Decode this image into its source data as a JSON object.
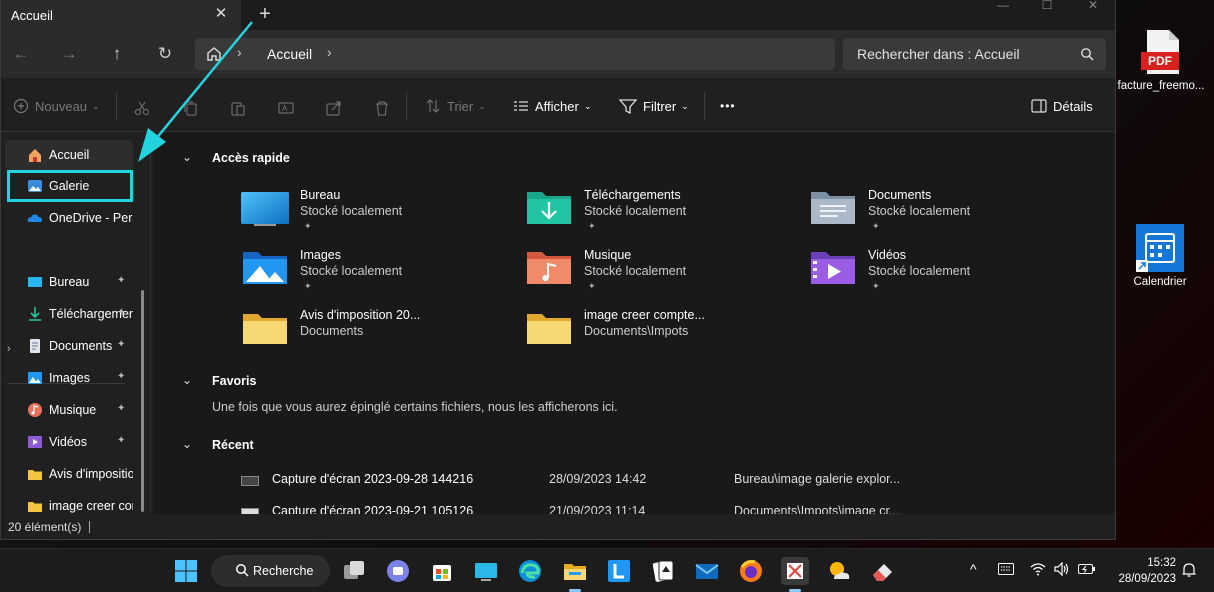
{
  "window": {
    "tab_title": "Accueil",
    "tab_close": "✕",
    "tab_new": "+",
    "controls": [
      "—",
      "☐",
      "✕"
    ]
  },
  "nav": {
    "back": "←",
    "forward": "→",
    "up": "↑",
    "refresh": "↻",
    "breadcrumb": "Accueil",
    "sep": "›",
    "search_placeholder": "Rechercher dans : Accueil"
  },
  "toolbar": {
    "new_label": "Nouveau",
    "sort_label": "Trier",
    "view_label": "Afficher",
    "filter_label": "Filtrer",
    "more_label": "•••",
    "details_label": "Détails"
  },
  "sidebar": {
    "items": [
      {
        "label": "Accueil",
        "icon": "home-icon",
        "pinned": false
      },
      {
        "label": "Galerie",
        "icon": "gallery-icon",
        "pinned": false
      },
      {
        "label": "OneDrive - Personal",
        "icon": "onedrive-icon",
        "pinned": false
      },
      {
        "label": "Bureau",
        "icon": "desktop-folder-icon",
        "pinned": true
      },
      {
        "label": "Téléchargements",
        "icon": "download-folder-icon",
        "pinned": true
      },
      {
        "label": "Documents",
        "icon": "documents-folder-icon",
        "pinned": true
      },
      {
        "label": "Images",
        "icon": "pictures-folder-icon",
        "pinned": true
      },
      {
        "label": "Musique",
        "icon": "music-folder-icon",
        "pinned": true
      },
      {
        "label": "Vidéos",
        "icon": "videos-folder-icon",
        "pinned": true
      },
      {
        "label": "Avis d'imposition",
        "icon": "folder-icon",
        "pinned": false
      },
      {
        "label": "image creer compte",
        "icon": "folder-icon",
        "pinned": false
      }
    ],
    "pin_glyph": "📌",
    "expand_glyph": "›"
  },
  "main": {
    "quick_access": {
      "title": "Accès rapide",
      "items": [
        {
          "name": "Bureau",
          "sub": "Stocké localement",
          "pinned": true,
          "icon": "desktop-folder-icon"
        },
        {
          "name": "Téléchargements",
          "sub": "Stocké localement",
          "pinned": true,
          "icon": "download-folder-icon"
        },
        {
          "name": "Documents",
          "sub": "Stocké localement",
          "pinned": true,
          "icon": "documents-folder-icon"
        },
        {
          "name": "Images",
          "sub": "Stocké localement",
          "pinned": true,
          "icon": "pictures-folder-icon"
        },
        {
          "name": "Musique",
          "sub": "Stocké localement",
          "pinned": true,
          "icon": "music-folder-icon"
        },
        {
          "name": "Vidéos",
          "sub": "Stocké localement",
          "pinned": true,
          "icon": "videos-folder-icon"
        },
        {
          "name": "Avis d'imposition 20...",
          "sub": "Documents",
          "pinned": false,
          "icon": "folder-icon"
        },
        {
          "name": "image creer compte...",
          "sub": "Documents\\Impots",
          "pinned": false,
          "icon": "folder-icon"
        }
      ]
    },
    "favorites": {
      "title": "Favoris",
      "note": "Une fois que vous aurez épinglé certains fichiers, nous les afficherons ici."
    },
    "recent": {
      "title": "Récent",
      "rows": [
        {
          "name": "Capture d'écran 2023-09-28 144216",
          "date": "28/09/2023 14:42",
          "location": "Bureau\\image galerie explor..."
        },
        {
          "name": "Capture d'écran 2023-09-21 105126",
          "date": "21/09/2023 11:14",
          "location": "Documents\\Impots\\image cr..."
        }
      ]
    }
  },
  "status": {
    "count": "20 élément(s)"
  },
  "desktop": {
    "icons": [
      {
        "label": "facture_freemo...",
        "icon": "pdf-file-icon",
        "badge": "PDF"
      },
      {
        "label": "Calendrier",
        "icon": "calendar-icon"
      }
    ]
  },
  "taskbar": {
    "search_label": "Recherche",
    "time": "15:32",
    "date": "28/09/2023",
    "tray_up": "^"
  },
  "colors": {
    "accent_highlight": "#22d3e0",
    "window_bg": "#202020",
    "main_bg": "#191919",
    "folder_yellow": "#f5c542"
  }
}
